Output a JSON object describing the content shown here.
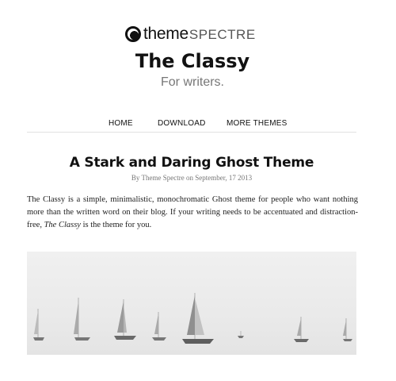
{
  "logo": {
    "word_theme": "theme",
    "word_spectre": "SPECTRE"
  },
  "site": {
    "title": "The Classy",
    "tagline": "For writers."
  },
  "nav": {
    "items": [
      "HOME",
      "DOWNLOAD",
      "MORE THEMES"
    ]
  },
  "post": {
    "title": "A Stark and Daring Ghost Theme",
    "meta": "By Theme Spectre on September, 17 2013",
    "body_before": "The Classy is a simple, minimalistic, monochromatic Ghost theme for people who want nothing more than the written word on their blog. If your writing needs to be accentuated and distraction-free, ",
    "body_em": "The Classy",
    "body_after": " is the theme for you."
  },
  "colors": {
    "background": "#ffffff",
    "text": "#111111",
    "muted": "#777777",
    "rule": "#e2e2e2"
  }
}
